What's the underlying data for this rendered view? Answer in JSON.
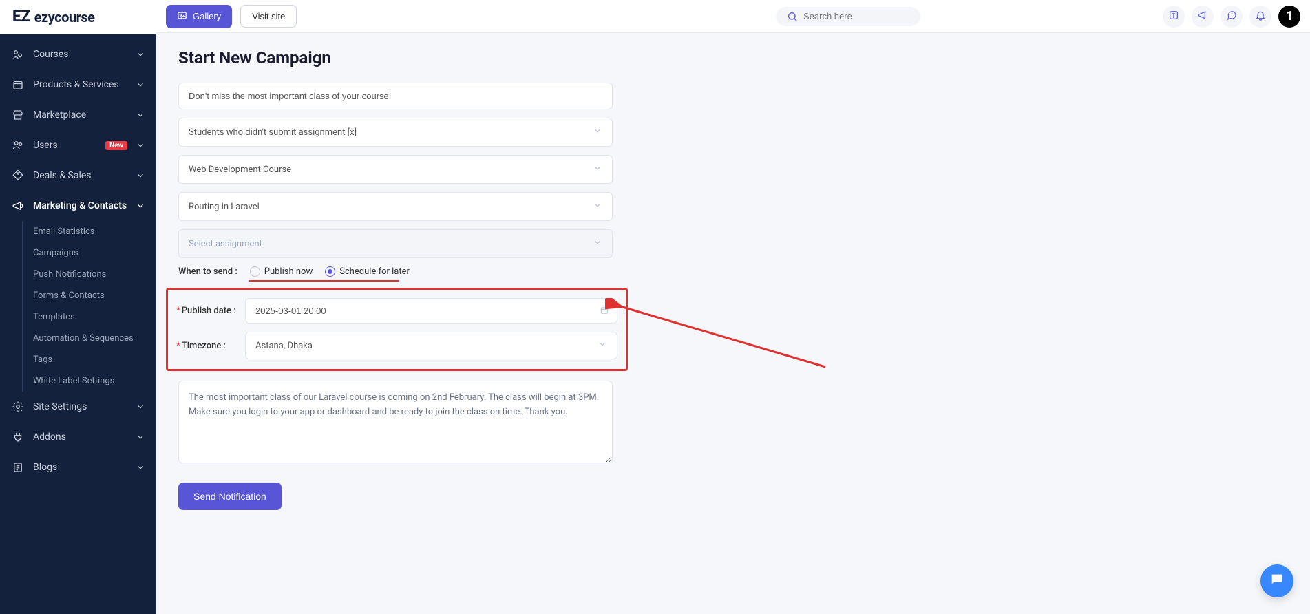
{
  "brand": {
    "mark": "EZ",
    "name": "ezycourse"
  },
  "header": {
    "gallery_label": "Gallery",
    "visit_label": "Visit site",
    "search_placeholder": "Search here",
    "avatar_initial": "1"
  },
  "sidebar": {
    "items": [
      {
        "label": "Courses",
        "icon": "courses"
      },
      {
        "label": "Products & Services",
        "icon": "box"
      },
      {
        "label": "Marketplace",
        "icon": "store"
      },
      {
        "label": "Users",
        "icon": "users",
        "badge": "New"
      },
      {
        "label": "Deals & Sales",
        "icon": "tag"
      },
      {
        "label": "Marketing & Contacts",
        "icon": "megaphone",
        "active": true
      },
      {
        "label": "Site Settings",
        "icon": "gear"
      },
      {
        "label": "Addons",
        "icon": "plug"
      },
      {
        "label": "Blogs",
        "icon": "doc"
      }
    ],
    "subitems": [
      "Email Statistics",
      "Campaigns",
      "Push Notifications",
      "Forms & Contacts",
      "Templates",
      "Automation & Sequences",
      "Tags",
      "White Label Settings"
    ]
  },
  "page": {
    "title": "Start New Campaign",
    "subject_value": "Don't miss the most important class of your course!",
    "segment_value": "Students who didn't submit assignment [x]",
    "course_value": "Web Development Course",
    "lesson_value": "Routing in Laravel",
    "assignment_placeholder": "Select assignment",
    "when_label": "When to send :",
    "radio_now": "Publish now",
    "radio_later": "Schedule for later",
    "publish_date_label": "Publish date :",
    "publish_date_value": "2025-03-01 20:00",
    "timezone_label": "Timezone :",
    "timezone_value": "Astana, Dhaka",
    "message_value": "The most important class of our Laravel course is coming on 2nd February. The class will begin at 3PM. Make sure you login to your app or dashboard and be ready to join the class on time. Thank you.",
    "submit_label": "Send Notification"
  }
}
